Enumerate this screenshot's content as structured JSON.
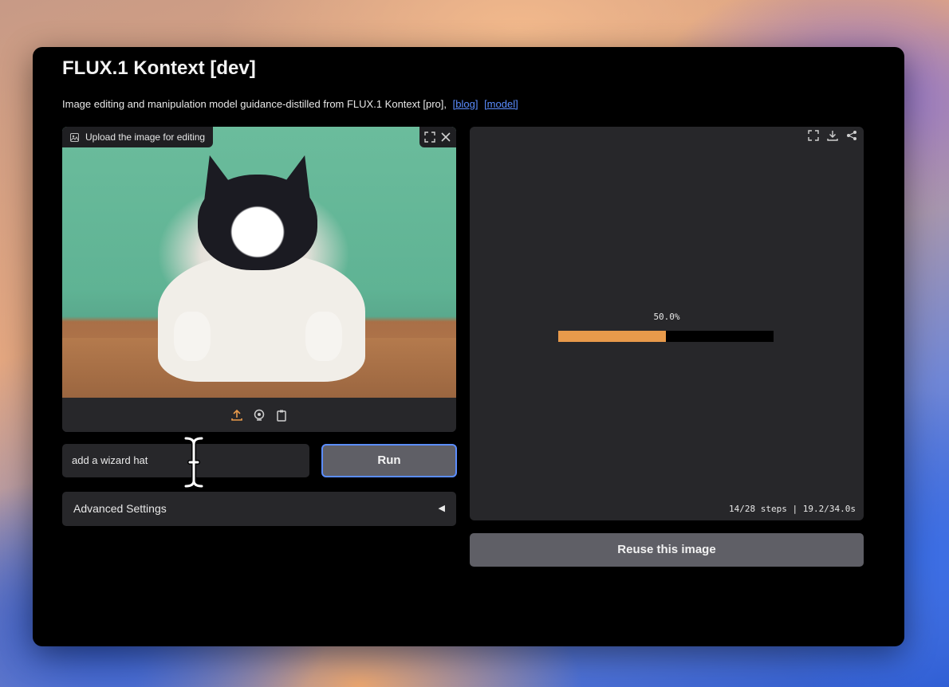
{
  "app": {
    "title": "FLUX.1 Kontext [dev]",
    "description": "Image editing and manipulation model guidance-distilled from FLUX.1 Kontext [pro],",
    "links": [
      {
        "label": "[blog]"
      },
      {
        "label": "[model]"
      }
    ]
  },
  "input_image": {
    "label": "Upload the image for editing",
    "label_icon": "image-icon",
    "tools": [
      "fullscreen-icon",
      "close-icon"
    ],
    "footer_icons": [
      "upload-icon",
      "webcam-icon",
      "clipboard-icon"
    ]
  },
  "prompt": {
    "value": "add a wizard hat"
  },
  "run_button": {
    "label": "Run"
  },
  "advanced_settings": {
    "label": "Advanced Settings",
    "icon": "caret-left-icon"
  },
  "output": {
    "tools": [
      "fullscreen-icon",
      "download-icon",
      "share-icon"
    ],
    "progress": {
      "text": "50.0%",
      "fraction": 0.5
    },
    "steps_text": "14/28 steps | 19.2/34.0s"
  },
  "reuse_button": {
    "label": "Reuse this image"
  },
  "colors": {
    "accent": "#e89a4b",
    "link": "#5b8dff",
    "panel": "#27272a"
  }
}
